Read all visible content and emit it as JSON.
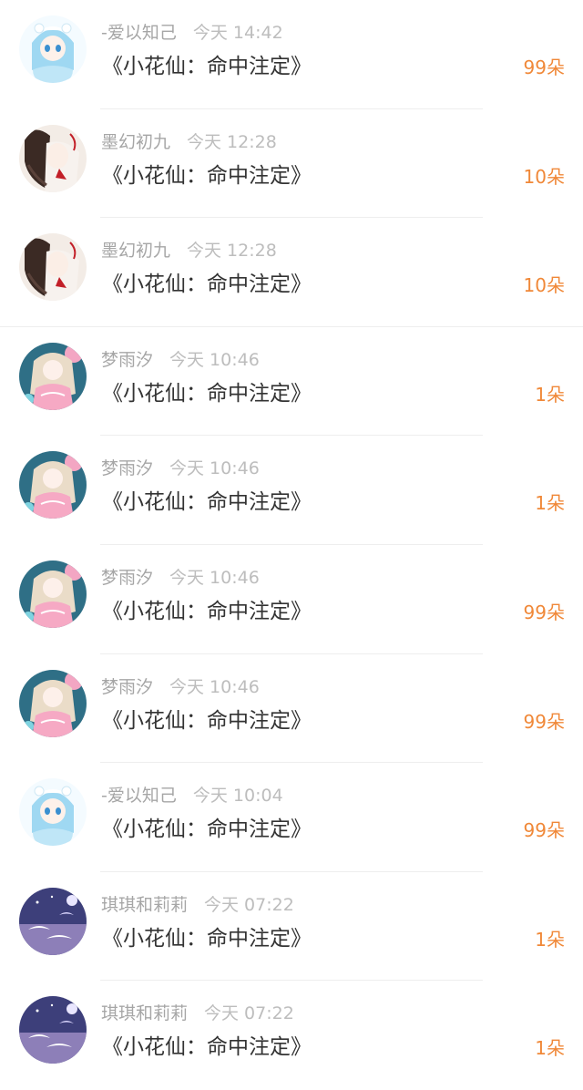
{
  "colors": {
    "gift_count": "#f08838",
    "name": "#a6a6a6",
    "title": "#333333",
    "separator": "#eeeeee"
  },
  "items": [
    {
      "name": "-爱以知己",
      "time": "今天 14:42",
      "title": "《小花仙：命中注定》",
      "gift": "99朵",
      "avatar": "snow-girl-avatar-icon"
    },
    {
      "name": "墨幻初九",
      "time": "今天 12:28",
      "title": "《小花仙：命中注定》",
      "gift": "10朵",
      "avatar": "red-ribbon-girl-avatar-icon"
    },
    {
      "name": "墨幻初九",
      "time": "今天 12:28",
      "title": "《小花仙：命中注定》",
      "gift": "10朵",
      "avatar": "red-ribbon-girl-avatar-icon"
    },
    {
      "name": "梦雨汐",
      "time": "今天 10:46",
      "title": "《小花仙：命中注定》",
      "gift": "1朵",
      "avatar": "pink-dress-girl-avatar-icon"
    },
    {
      "name": "梦雨汐",
      "time": "今天 10:46",
      "title": "《小花仙：命中注定》",
      "gift": "1朵",
      "avatar": "pink-dress-girl-avatar-icon"
    },
    {
      "name": "梦雨汐",
      "time": "今天 10:46",
      "title": "《小花仙：命中注定》",
      "gift": "99朵",
      "avatar": "pink-dress-girl-avatar-icon"
    },
    {
      "name": "梦雨汐",
      "time": "今天 10:46",
      "title": "《小花仙：命中注定》",
      "gift": "99朵",
      "avatar": "pink-dress-girl-avatar-icon"
    },
    {
      "name": "-爱以知己",
      "time": "今天 10:04",
      "title": "《小花仙：命中注定》",
      "gift": "99朵",
      "avatar": "snow-girl-avatar-icon"
    },
    {
      "name": "琪琪和莉莉",
      "time": "今天 07:22",
      "title": "《小花仙：命中注定》",
      "gift": "1朵",
      "avatar": "night-sky-birds-avatar-icon"
    },
    {
      "name": "琪琪和莉莉",
      "time": "今天 07:22",
      "title": "《小花仙：命中注定》",
      "gift": "1朵",
      "avatar": "night-sky-birds-avatar-icon"
    }
  ]
}
